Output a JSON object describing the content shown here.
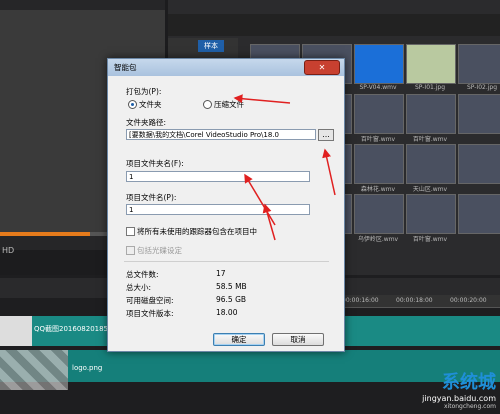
{
  "background": {
    "hd_label": "HD",
    "library_tag": "样本",
    "timeline_track1_label": "QQ截图201608201855",
    "timeline_track2_label": "logo.png",
    "thumbnails": [
      {
        "label": ""
      },
      {
        "label": ""
      },
      {
        "label": "SP-V04.wmv"
      },
      {
        "label": "SP-I01.jpg"
      },
      {
        "label": "SP-I02.jpg"
      },
      {
        "label": ""
      },
      {
        "label": ""
      },
      {
        "label": "百叶窗.wmv"
      },
      {
        "label": "百叶窗.wmv"
      },
      {
        "label": ""
      },
      {
        "label": ""
      },
      {
        "label": ""
      },
      {
        "label": "森林花.wmv"
      },
      {
        "label": "天山区.wmv"
      },
      {
        "label": ""
      },
      {
        "label": ""
      },
      {
        "label": ""
      },
      {
        "label": "乌伊岭区.wmv"
      },
      {
        "label": "百叶窗.wmv"
      },
      {
        "label": ""
      }
    ],
    "ruler_ticks": [
      "00:00:16:00",
      "00:00:18:00",
      "00:00:20:00"
    ]
  },
  "dialog": {
    "title": "智能包",
    "close_label": "✕",
    "pack_as_label": "打包为(P):",
    "option_folder": "文件夹",
    "option_zip": "压缩文件",
    "folder_path_label": "文件夹路径:",
    "folder_path_value": "[要数据\\我的文档\\Corel VideoStudio Pro\\18.0",
    "browse_label": "...",
    "project_folder_label": "项目文件夹名(F):",
    "project_folder_value": "1",
    "project_file_label": "项目文件名(P):",
    "project_file_value": "1",
    "include_tracker_label": "将所有未使用的跟踪器包含在项目中",
    "include_disc_label": "包括光碟设定",
    "stats": [
      {
        "label": "总文件数:",
        "value": "17"
      },
      {
        "label": "总大小:",
        "value": "58.5 MB"
      },
      {
        "label": "可用磁盘空间:",
        "value": "96.5 GB"
      },
      {
        "label": "项目文件版本:",
        "value": "18.00"
      }
    ],
    "ok_label": "确定",
    "cancel_label": "取消"
  },
  "watermark": {
    "brand": "系统城",
    "site": "jingyan.baidu.com",
    "site2": "xitongcheng.com"
  },
  "colors": {
    "accent": "#1f5fa8",
    "arrow": "#e02020",
    "timeline_track": "#1a8a84"
  }
}
